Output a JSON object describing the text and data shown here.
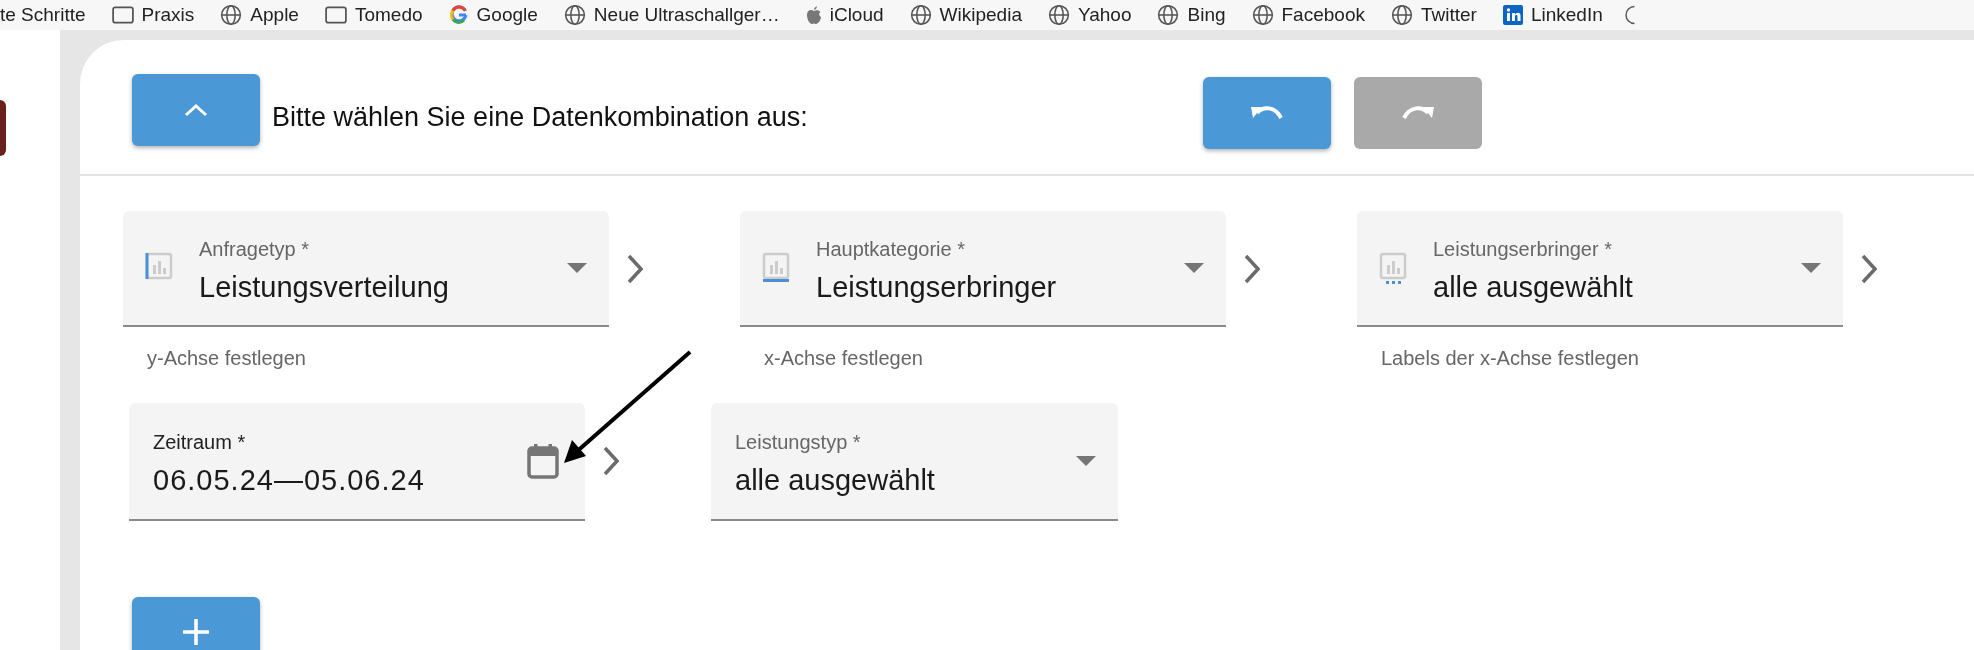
{
  "bookmarks": [
    {
      "label": "te Schritte"
    },
    {
      "label": "Praxis"
    },
    {
      "label": "Apple"
    },
    {
      "label": "Tomedo"
    },
    {
      "label": "Google"
    },
    {
      "label": "Neue Ultraschallger…"
    },
    {
      "label": "iCloud"
    },
    {
      "label": "Wikipedia"
    },
    {
      "label": "Yahoo"
    },
    {
      "label": "Bing"
    },
    {
      "label": "Facebook"
    },
    {
      "label": "Twitter"
    },
    {
      "label": "LinkedIn"
    }
  ],
  "header": {
    "title": "Bitte wählen Sie eine Datenkombination aus:",
    "undo": {
      "disabled": false
    },
    "redo": {
      "disabled": true
    }
  },
  "rows": [
    {
      "fields": [
        {
          "kind": "select",
          "label": "Anfragetyp *",
          "value": "Leistungsverteilung",
          "helper": "y-Achse festlegen"
        },
        {
          "kind": "select",
          "label": "Hauptkategorie *",
          "value": "Leistungserbringer",
          "helper": "x-Achse festlegen"
        },
        {
          "kind": "select",
          "label": "Leistungserbringer *",
          "value": "alle ausgewählt",
          "helper": "Labels der x-Achse festlegen"
        }
      ]
    },
    {
      "fields": [
        {
          "kind": "date",
          "label": "Zeitraum *",
          "value": "06.05.24—05.06.24"
        },
        {
          "kind": "select",
          "label": "Leistungstyp *",
          "value": "alle ausgewählt"
        }
      ]
    }
  ]
}
